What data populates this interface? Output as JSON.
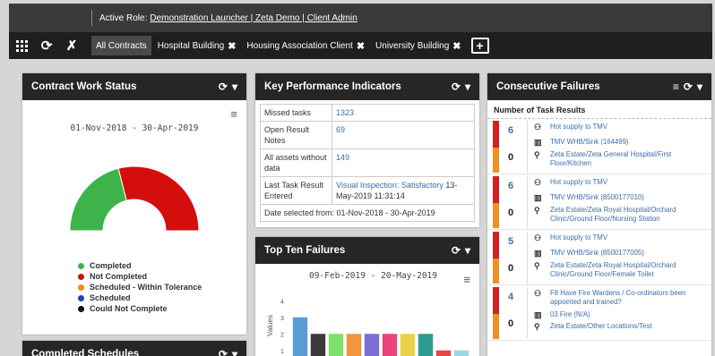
{
  "topbar": {
    "role_label": "Active Role:",
    "role_value": "Demonstration Launcher | Zeta Demo | Client Admin"
  },
  "nav": {
    "icons": [
      "grid-icon",
      "refresh-icon",
      "tools-icon"
    ],
    "tabs": [
      {
        "label": "All Contracts"
      },
      {
        "label": "Hospital Building"
      },
      {
        "label": "Housing Association Client"
      },
      {
        "label": "University Building"
      }
    ],
    "close_glyph": "✖",
    "add_glyph": "+"
  },
  "contract_work_status": {
    "title": "Contract Work Status",
    "date_range": "01-Nov-2018 - 30-Apr-2019",
    "chart_data": {
      "type": "pie",
      "variant": "semi-donut",
      "series": [
        {
          "name": "Completed",
          "value": 42,
          "color": "#3cb44b"
        },
        {
          "name": "Not Completed",
          "value": 58,
          "color": "#d40d0d"
        },
        {
          "name": "Scheduled - Within Tolerance",
          "value": 0,
          "color": "#f08a24"
        },
        {
          "name": "Scheduled",
          "value": 0,
          "color": "#1f3fbf"
        },
        {
          "name": "Could Not Complete",
          "value": 0,
          "color": "#111111"
        }
      ]
    }
  },
  "completed_schedules": {
    "title": "Completed Schedules"
  },
  "kpi": {
    "title": "Key Performance Indicators",
    "rows": [
      {
        "label": "Missed tasks",
        "value": "1323",
        "extra": ""
      },
      {
        "label": "Open Result Notes",
        "value": "69",
        "extra": ""
      },
      {
        "label": "All assets without data",
        "value": "149",
        "extra": ""
      },
      {
        "label": "Last Task Result Entered",
        "value": "Visual Inspection: Satisfactory",
        "extra": "13-May-2019 11:31:14"
      }
    ],
    "footer": "Date selected from: 01-Nov-2018 - 30-Apr-2019"
  },
  "top_ten": {
    "title": "Top Ten Failures",
    "date_range": "09-Feb-2019 - 20-May-2019",
    "chart_data": {
      "type": "bar",
      "ylabel": "Values",
      "yticks": [
        1,
        2,
        3,
        4
      ],
      "ylim": [
        0.5,
        4.5
      ],
      "values": [
        3,
        2,
        2,
        2,
        2,
        2,
        2,
        2,
        1,
        1
      ],
      "colors": [
        "#5b9bd5",
        "#3a3a3a",
        "#7ee06a",
        "#f0963c",
        "#7b6fd6",
        "#e8457a",
        "#e8d24a",
        "#2e9a8e",
        "#e84545",
        "#9ad6e8"
      ]
    }
  },
  "consecutive": {
    "title": "Consecutive Failures",
    "column_header": "Number of Task Results",
    "items": [
      {
        "count": "6",
        "zero": "0",
        "task": "Hot supply to TMV",
        "asset": "TMV WHB/Sink (164499)",
        "location": "Zeta Estate/Zeta General Hospital/First Floor/Kitchen"
      },
      {
        "count": "6",
        "zero": "0",
        "task": "Hot supply to TMV",
        "asset": "TMV WHB/Sink (8500177010)",
        "location": "Zeta Estate/Zeta Royal Hospital/Orchard Clinic/Ground Floor/Nursing Station"
      },
      {
        "count": "5",
        "zero": "0",
        "task": "Hot supply to TMV",
        "asset": "TMV WHB/Sink (8500177005)",
        "location": "Zeta Estate/Zeta Royal Hospital/Orchard Clinic/Ground Floor/Female Toilet"
      },
      {
        "count": "4",
        "zero": "0",
        "task": "F8 Have Fire Wardens / Co-ordinators been appointed and trained?",
        "asset": "03 Fire (N/A)",
        "location": "Zeta Estate/Other Locations/Test"
      }
    ]
  }
}
